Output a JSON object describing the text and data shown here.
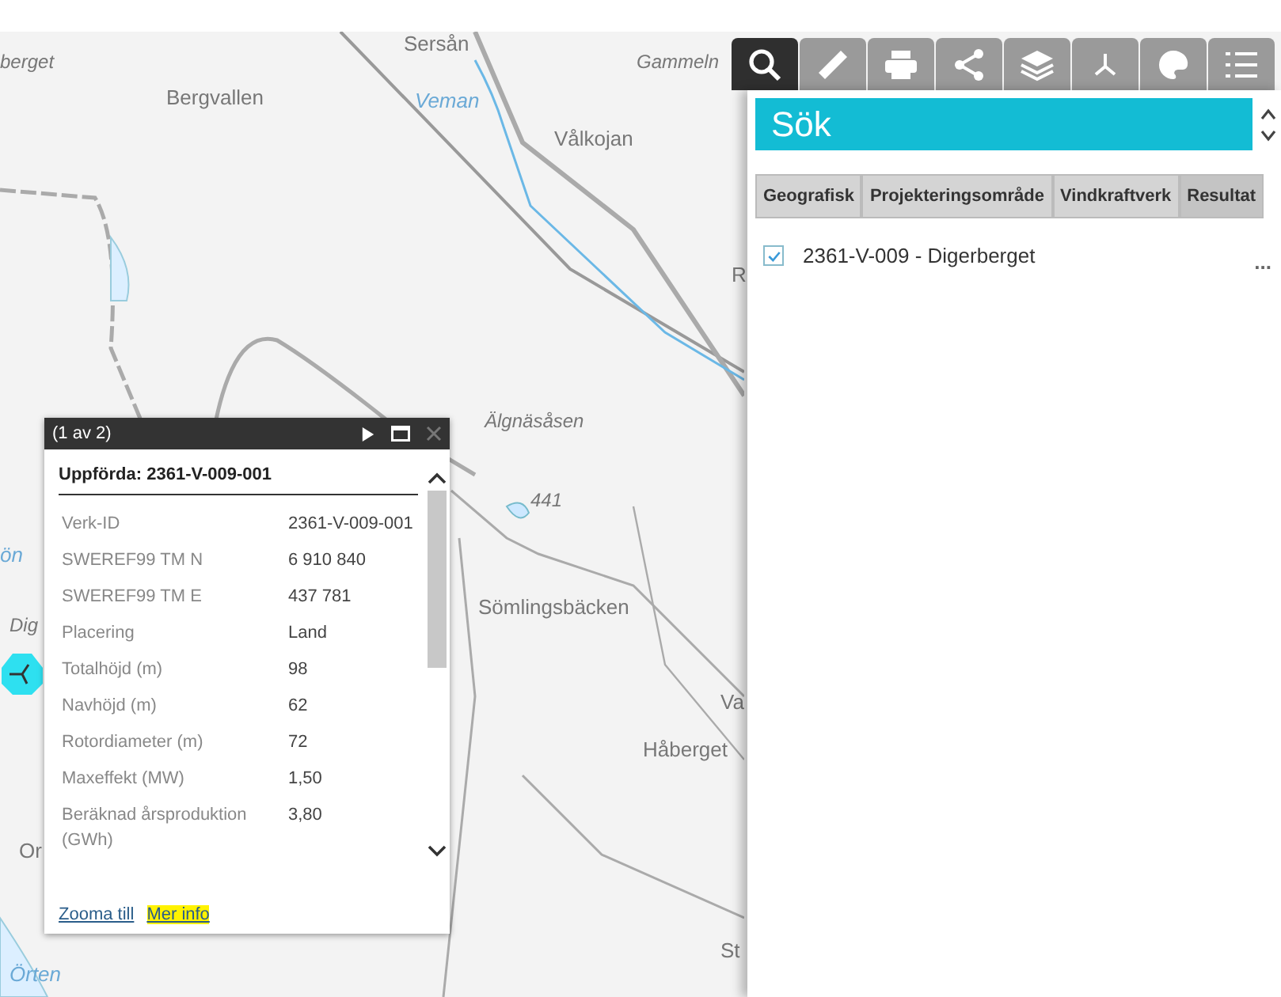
{
  "map": {
    "labels": [
      {
        "text": "berget",
        "kind": "italic"
      },
      {
        "text": "Bergvallen",
        "kind": "place"
      },
      {
        "text": "Sersån",
        "kind": "place"
      },
      {
        "text": "Veman",
        "kind": "water"
      },
      {
        "text": "Gammeln",
        "kind": "italic"
      },
      {
        "text": "Vålkojan",
        "kind": "place"
      },
      {
        "text": "R",
        "kind": "place"
      },
      {
        "text": "Älgnäsåsen",
        "kind": "italic"
      },
      {
        "text": "441",
        "kind": "italic"
      },
      {
        "text": "Sömlingsbäcken",
        "kind": "place"
      },
      {
        "text": "Va",
        "kind": "place"
      },
      {
        "text": "Håberget",
        "kind": "place"
      },
      {
        "text": "ön",
        "kind": "water"
      },
      {
        "text": "Dig",
        "kind": "italic"
      },
      {
        "text": "Or",
        "kind": "place"
      },
      {
        "text": "Örten",
        "kind": "water"
      },
      {
        "text": "St",
        "kind": "place"
      }
    ]
  },
  "toolbar": [
    {
      "kind": "search",
      "selected": true
    },
    {
      "kind": "measure",
      "selected": false
    },
    {
      "kind": "print",
      "selected": false
    },
    {
      "kind": "share",
      "selected": false
    },
    {
      "kind": "layers",
      "selected": false
    },
    {
      "kind": "coordinates",
      "selected": false
    },
    {
      "kind": "palette",
      "selected": false
    },
    {
      "kind": "legend",
      "selected": false
    }
  ],
  "search_panel": {
    "title": "Sök",
    "tabs": [
      {
        "label": "Geografisk",
        "selected": false
      },
      {
        "label": "Projekteringsområde",
        "selected": false
      },
      {
        "label": "Vindkraftverk",
        "selected": false
      },
      {
        "label": "Resultat",
        "selected": true
      }
    ],
    "results": [
      {
        "label": "2361-V-009 - Digerberget",
        "checked": true,
        "menu": "..."
      }
    ]
  },
  "popup": {
    "title": "(1 av 2)",
    "heading": "Uppförda: 2361-V-009-001",
    "rows": [
      {
        "label": "Verk-ID",
        "value": "2361-V-009-001"
      },
      {
        "label": "SWEREF99 TM N",
        "value": "6 910 840"
      },
      {
        "label": "SWEREF99 TM E",
        "value": "437 781"
      },
      {
        "label": "Placering",
        "value": "Land"
      },
      {
        "label": "Totalhöjd (m)",
        "value": "98"
      },
      {
        "label": "Navhöjd (m)",
        "value": "62"
      },
      {
        "label": "Rotordiameter (m)",
        "value": "72"
      },
      {
        "label": "Maxeffekt (MW)",
        "value": "1,50"
      },
      {
        "label": "Beräknad årsproduktion (GWh)",
        "value": "3,80"
      }
    ],
    "links": [
      {
        "label": "Zooma till",
        "highlighted": false
      },
      {
        "label": "Mer info",
        "highlighted": true
      }
    ]
  }
}
